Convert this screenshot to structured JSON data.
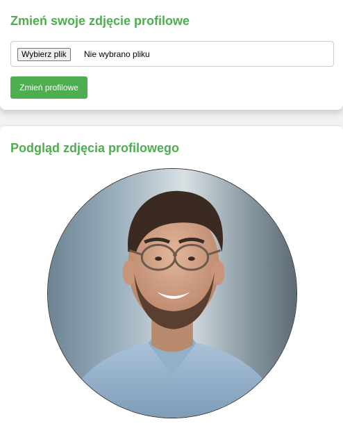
{
  "upload_section": {
    "title": "Zmień swoje zdjęcie profilowe",
    "file_input": {
      "button_label": "Wybierz plik",
      "status": "Nie wybrano pliku"
    },
    "submit_label": "Zmień profilowe"
  },
  "preview_section": {
    "title": "Podgląd zdjęcia profilowego",
    "image_icon": "profile-photo"
  },
  "colors": {
    "accent": "#4cae4f",
    "background": "#f2f2f2",
    "card": "#ffffff"
  }
}
